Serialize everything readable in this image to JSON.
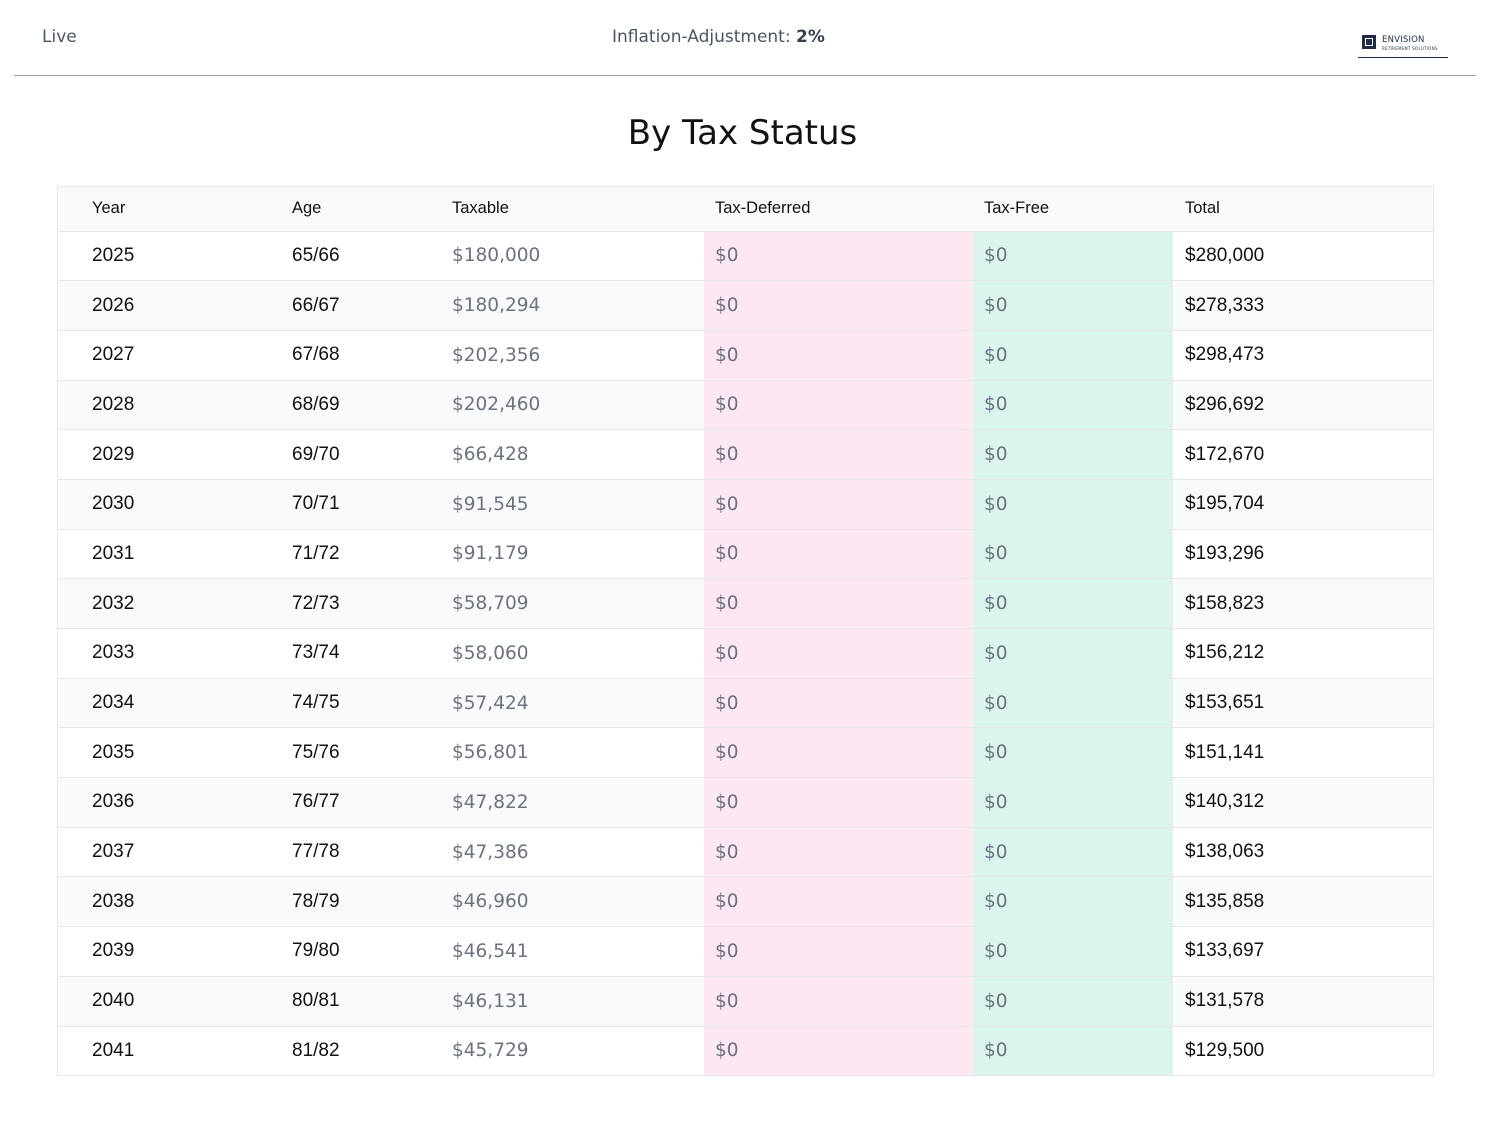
{
  "header": {
    "mode_label": "Live",
    "inflation_label": "Inflation-Adjustment:",
    "inflation_value": "2%",
    "logo": {
      "name": "ENVISION",
      "tagline": "RETIREMENT SOLUTIONS"
    }
  },
  "page": {
    "title": "By Tax Status"
  },
  "colors": {
    "tax_deferred_bg": "#fce7f3",
    "tax_free_bg": "#dcf5ec",
    "stripe_bg": "#f9fafb"
  },
  "table": {
    "columns": [
      "Year",
      "Age",
      "Taxable",
      "Tax-Deferred",
      "Tax-Free",
      "Total"
    ],
    "rows": [
      {
        "year": "2025",
        "age": "65/66",
        "taxable": "$180,000",
        "tax_deferred": "$0",
        "tax_free": "$0",
        "total": "$280,000"
      },
      {
        "year": "2026",
        "age": "66/67",
        "taxable": "$180,294",
        "tax_deferred": "$0",
        "tax_free": "$0",
        "total": "$278,333"
      },
      {
        "year": "2027",
        "age": "67/68",
        "taxable": "$202,356",
        "tax_deferred": "$0",
        "tax_free": "$0",
        "total": "$298,473"
      },
      {
        "year": "2028",
        "age": "68/69",
        "taxable": "$202,460",
        "tax_deferred": "$0",
        "tax_free": "$0",
        "total": "$296,692"
      },
      {
        "year": "2029",
        "age": "69/70",
        "taxable": "$66,428",
        "tax_deferred": "$0",
        "tax_free": "$0",
        "total": "$172,670"
      },
      {
        "year": "2030",
        "age": "70/71",
        "taxable": "$91,545",
        "tax_deferred": "$0",
        "tax_free": "$0",
        "total": "$195,704"
      },
      {
        "year": "2031",
        "age": "71/72",
        "taxable": "$91,179",
        "tax_deferred": "$0",
        "tax_free": "$0",
        "total": "$193,296"
      },
      {
        "year": "2032",
        "age": "72/73",
        "taxable": "$58,709",
        "tax_deferred": "$0",
        "tax_free": "$0",
        "total": "$158,823"
      },
      {
        "year": "2033",
        "age": "73/74",
        "taxable": "$58,060",
        "tax_deferred": "$0",
        "tax_free": "$0",
        "total": "$156,212"
      },
      {
        "year": "2034",
        "age": "74/75",
        "taxable": "$57,424",
        "tax_deferred": "$0",
        "tax_free": "$0",
        "total": "$153,651"
      },
      {
        "year": "2035",
        "age": "75/76",
        "taxable": "$56,801",
        "tax_deferred": "$0",
        "tax_free": "$0",
        "total": "$151,141"
      },
      {
        "year": "2036",
        "age": "76/77",
        "taxable": "$47,822",
        "tax_deferred": "$0",
        "tax_free": "$0",
        "total": "$140,312"
      },
      {
        "year": "2037",
        "age": "77/78",
        "taxable": "$47,386",
        "tax_deferred": "$0",
        "tax_free": "$0",
        "total": "$138,063"
      },
      {
        "year": "2038",
        "age": "78/79",
        "taxable": "$46,960",
        "tax_deferred": "$0",
        "tax_free": "$0",
        "total": "$135,858"
      },
      {
        "year": "2039",
        "age": "79/80",
        "taxable": "$46,541",
        "tax_deferred": "$0",
        "tax_free": "$0",
        "total": "$133,697"
      },
      {
        "year": "2040",
        "age": "80/81",
        "taxable": "$46,131",
        "tax_deferred": "$0",
        "tax_free": "$0",
        "total": "$131,578"
      },
      {
        "year": "2041",
        "age": "81/82",
        "taxable": "$45,729",
        "tax_deferred": "$0",
        "tax_free": "$0",
        "total": "$129,500"
      }
    ]
  }
}
